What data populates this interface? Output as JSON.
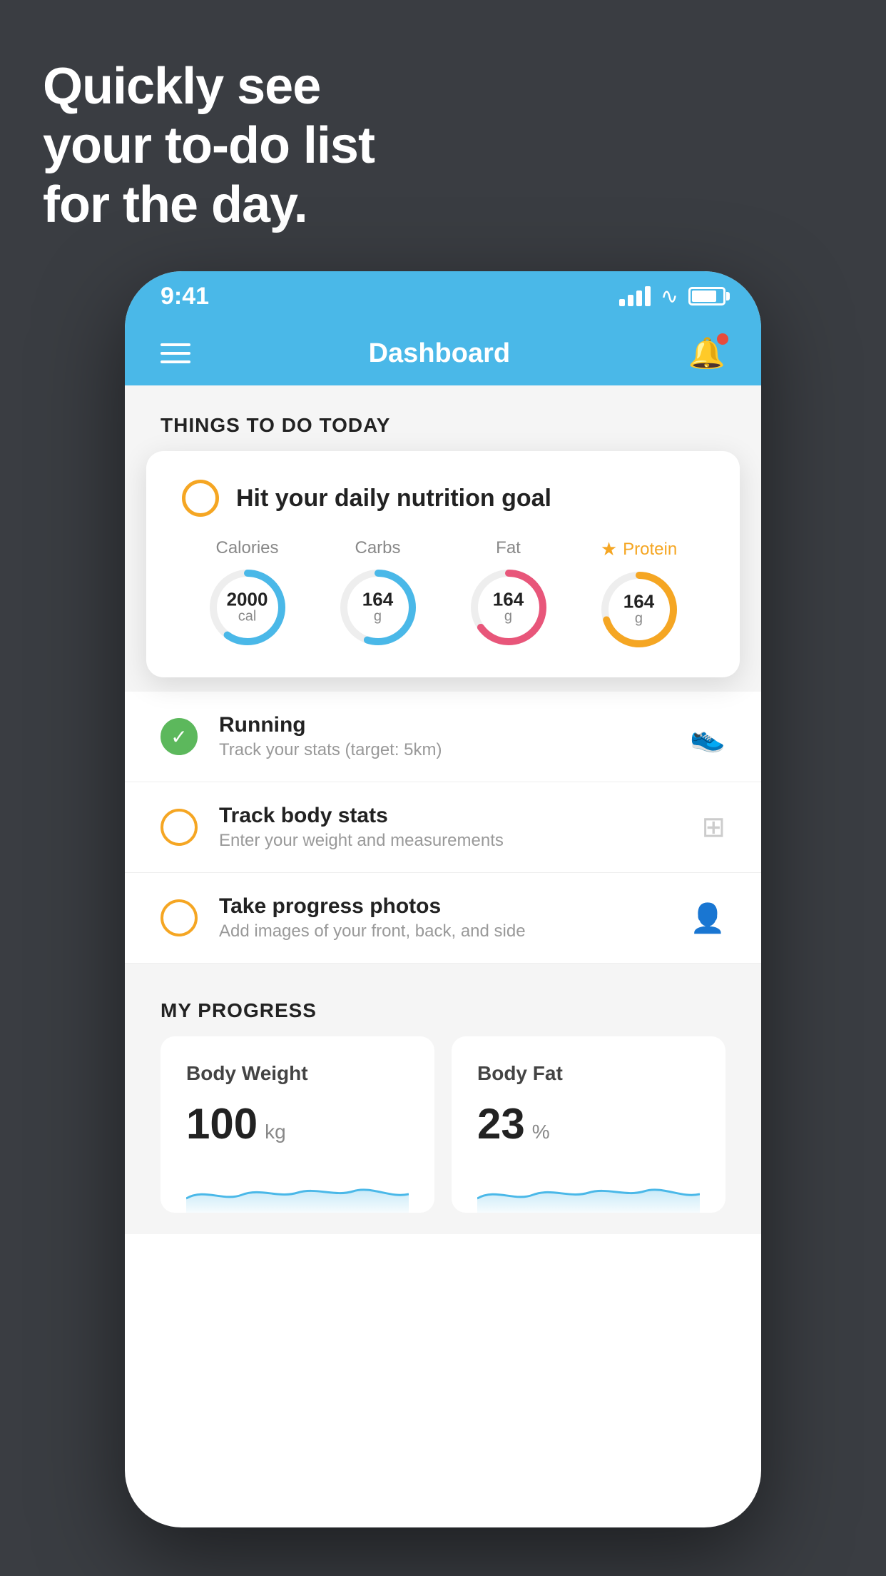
{
  "hero": {
    "line1": "Quickly see",
    "line2": "your to-do list",
    "line3": "for the day."
  },
  "statusBar": {
    "time": "9:41"
  },
  "navBar": {
    "title": "Dashboard"
  },
  "thingsSection": {
    "title": "THINGS TO DO TODAY"
  },
  "nutritionCard": {
    "title": "Hit your daily nutrition goal",
    "macros": [
      {
        "label": "Calories",
        "value": "2000",
        "unit": "cal",
        "color": "#4ab8e8",
        "percent": 60,
        "star": false
      },
      {
        "label": "Carbs",
        "value": "164",
        "unit": "g",
        "color": "#4ab8e8",
        "percent": 55,
        "star": false
      },
      {
        "label": "Fat",
        "value": "164",
        "unit": "g",
        "color": "#e8567a",
        "percent": 65,
        "star": false
      },
      {
        "label": "Protein",
        "value": "164",
        "unit": "g",
        "color": "#f5a623",
        "percent": 70,
        "star": true
      }
    ]
  },
  "todoItems": [
    {
      "name": "Running",
      "sub": "Track your stats (target: 5km)",
      "circleType": "green",
      "icon": "👟"
    },
    {
      "name": "Track body stats",
      "sub": "Enter your weight and measurements",
      "circleType": "yellow",
      "icon": "⊞"
    },
    {
      "name": "Take progress photos",
      "sub": "Add images of your front, back, and side",
      "circleType": "yellow",
      "icon": "👤"
    }
  ],
  "progressSection": {
    "title": "MY PROGRESS",
    "cards": [
      {
        "title": "Body Weight",
        "value": "100",
        "unit": "kg"
      },
      {
        "title": "Body Fat",
        "value": "23",
        "unit": "%"
      }
    ]
  }
}
